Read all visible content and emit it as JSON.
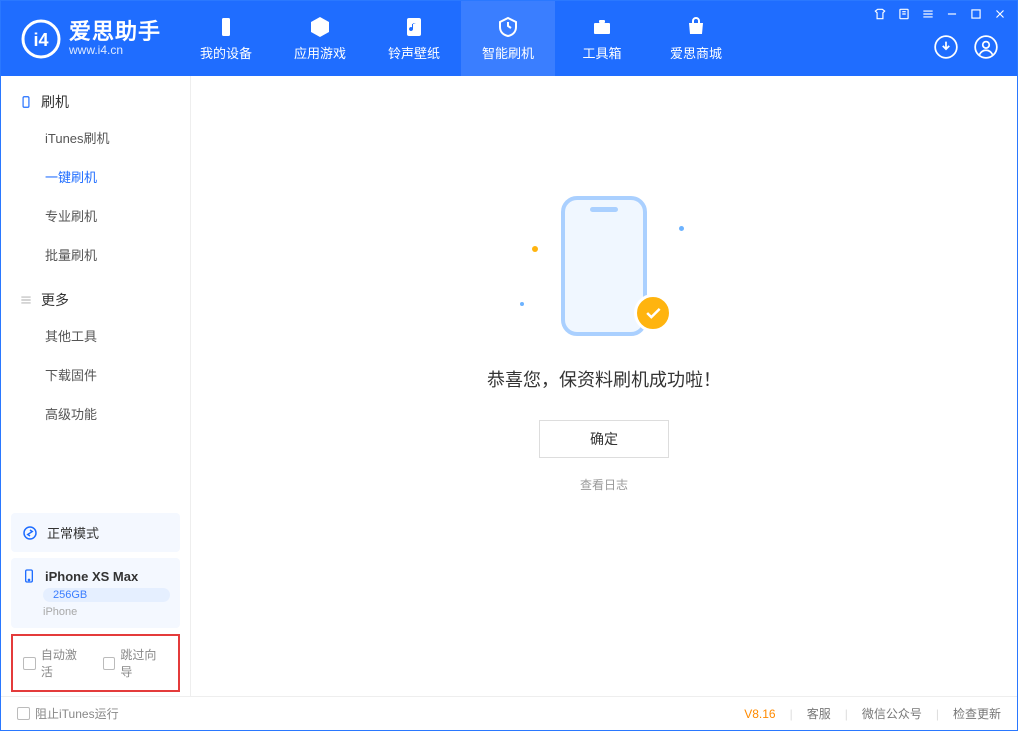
{
  "app": {
    "name": "爱思助手",
    "url": "www.i4.cn"
  },
  "nav": {
    "tabs": [
      {
        "label": "我的设备"
      },
      {
        "label": "应用游戏"
      },
      {
        "label": "铃声壁纸"
      },
      {
        "label": "智能刷机"
      },
      {
        "label": "工具箱"
      },
      {
        "label": "爱思商城"
      }
    ],
    "active_index": 3
  },
  "sidebar": {
    "section1_title": "刷机",
    "section1_items": [
      "iTunes刷机",
      "一键刷机",
      "专业刷机",
      "批量刷机"
    ],
    "section1_active_index": 1,
    "section2_title": "更多",
    "section2_items": [
      "其他工具",
      "下载固件",
      "高级功能"
    ],
    "mode_label": "正常模式",
    "device": {
      "name": "iPhone XS Max",
      "storage": "256GB",
      "type": "iPhone"
    },
    "checkboxes": {
      "auto_activate": "自动激活",
      "skip_guide": "跳过向导"
    }
  },
  "main": {
    "success_text": "恭喜您，保资料刷机成功啦！",
    "ok_button": "确定",
    "view_log": "查看日志"
  },
  "statusbar": {
    "block_itunes": "阻止iTunes运行",
    "version": "V8.16",
    "links": [
      "客服",
      "微信公众号",
      "检查更新"
    ]
  }
}
